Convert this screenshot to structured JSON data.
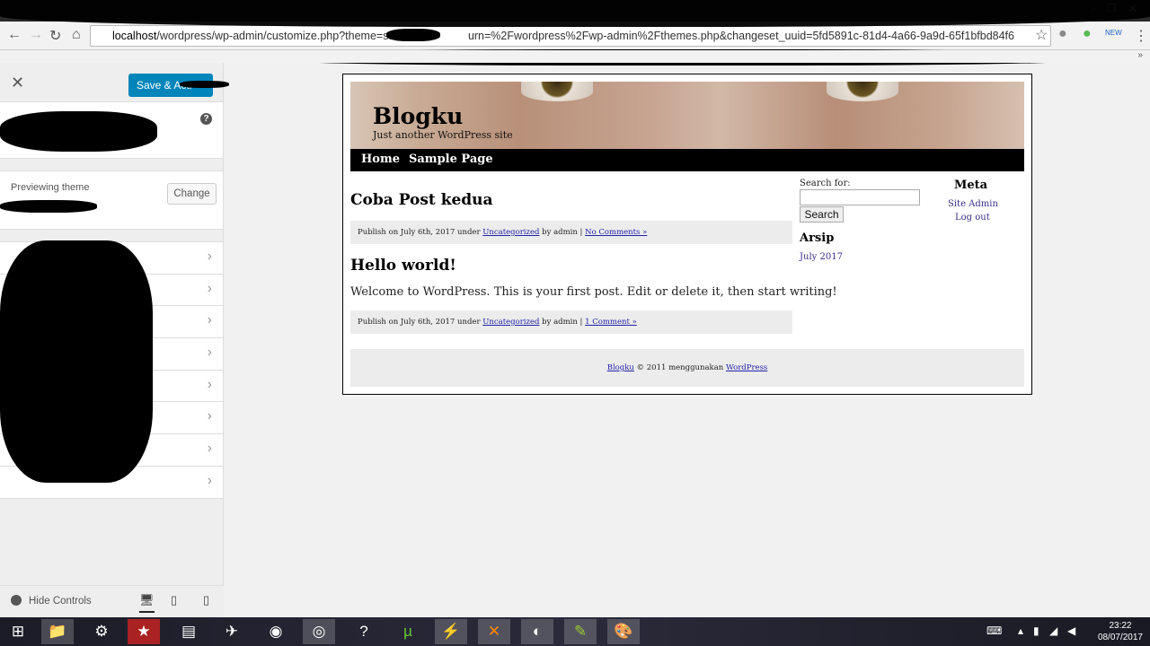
{
  "browser": {
    "url_host": "localhost",
    "url_rest": "/wordpress/wp-admin/customize.php?theme=st",
    "url_tail": "urn=%2Fwordpress%2Fwp-admin%2Fthemes.php&changeset_uuid=5fd5891c-81d4-4a66-9a9d-65f1bfbd84f6"
  },
  "customizer": {
    "save_label": "Save & Acti",
    "previewing_label": "Previewing theme",
    "change_label": "Change",
    "hide_controls": "Hide Controls",
    "section_count": 8
  },
  "site": {
    "title": "Blogku",
    "tagline": "Just another WordPress site",
    "menu": [
      "Home",
      "Sample Page"
    ],
    "posts": [
      {
        "title": "Coba Post kedua",
        "meta_prefix": "Publish on July 6th, 2017 under ",
        "category": "Uncategorized",
        "meta_mid": " by admin | ",
        "comments": "No Comments »"
      },
      {
        "title": "Hello world!",
        "excerpt": "Welcome to WordPress. This is your first post. Edit or delete it, then start writing!",
        "meta_prefix": "Publish on July 6th, 2017 under ",
        "category": "Uncategorized",
        "meta_mid": " by admin | ",
        "comments": "1 Comment »"
      }
    ],
    "search_label": "Search for:",
    "search_button": "Search",
    "archive_title": "Arsip",
    "archive_item": "July 2017",
    "meta_title": "Meta",
    "meta_links": [
      "Site Admin",
      "Log out"
    ],
    "footer": {
      "link1": "Blogku",
      "text": " © 2011 menggunakan ",
      "link2": "WordPress"
    }
  },
  "taskbar": {
    "time": "23:22",
    "date": "08/07/2017"
  }
}
